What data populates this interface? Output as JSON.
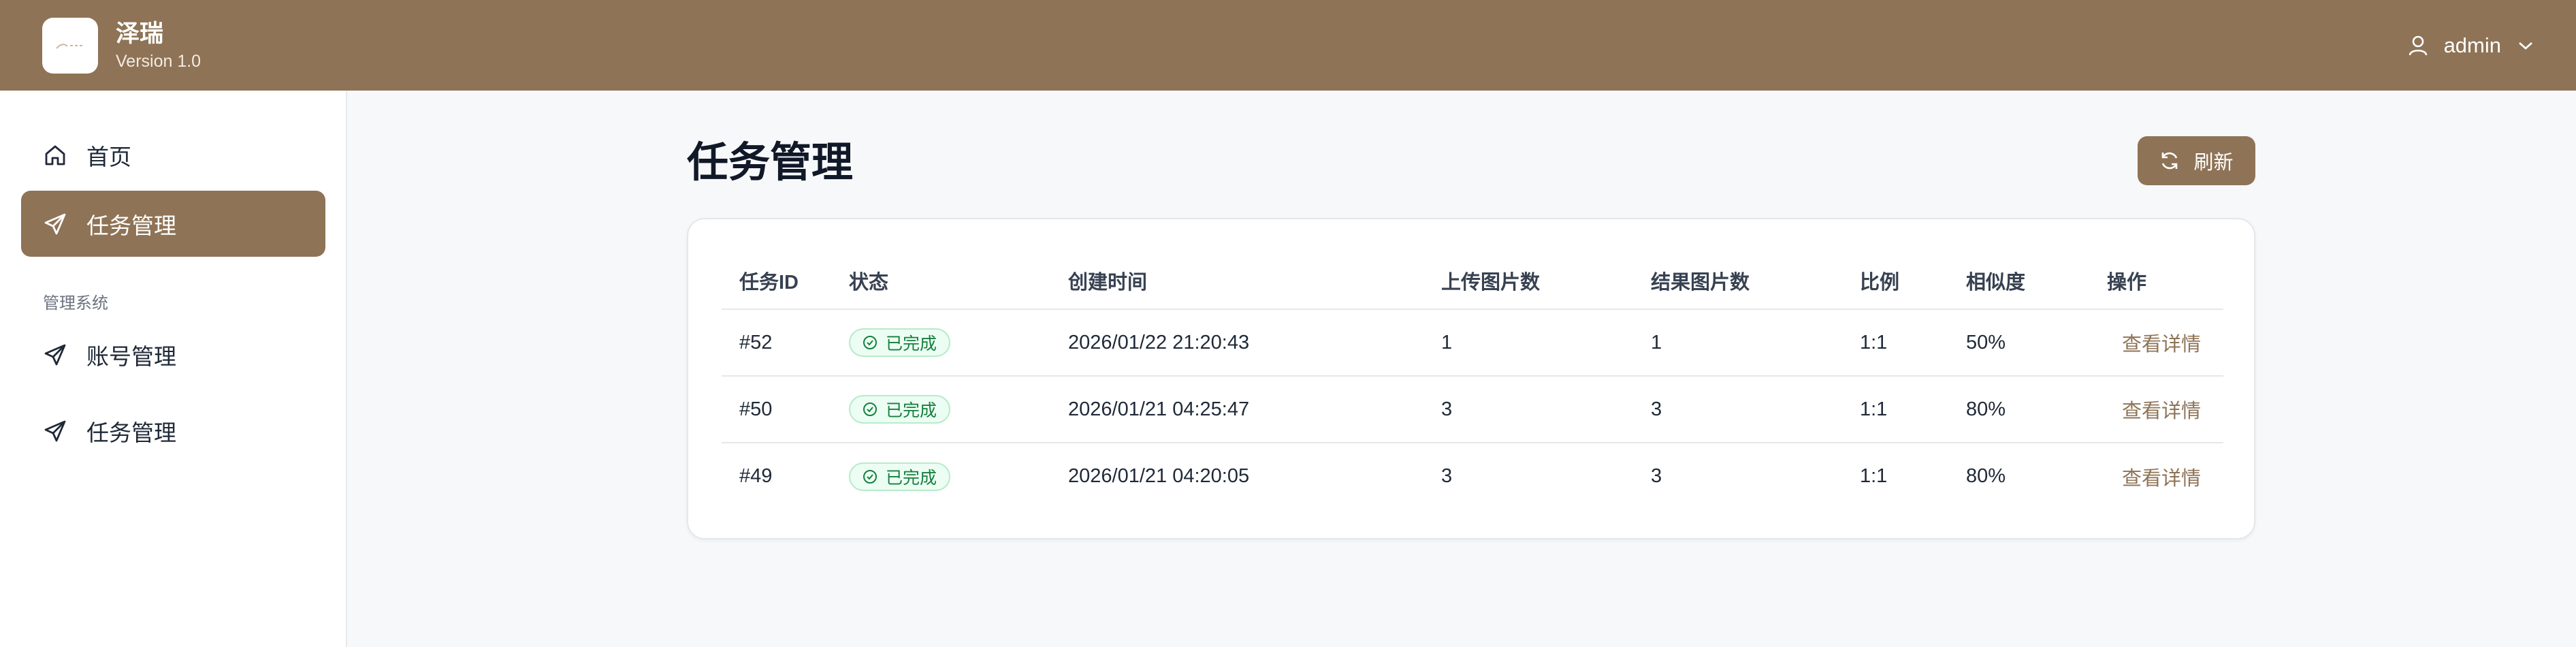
{
  "app": {
    "name": "泽瑞",
    "version": "Version 1.0",
    "user": "admin"
  },
  "sidebar": {
    "items": [
      {
        "label": "首页",
        "icon": "home-icon",
        "active": false
      },
      {
        "label": "任务管理",
        "icon": "send-icon",
        "active": true
      }
    ],
    "section_label": "管理系统",
    "section_items": [
      {
        "label": "账号管理",
        "icon": "send-icon"
      },
      {
        "label": "任务管理",
        "icon": "send-icon"
      }
    ]
  },
  "main": {
    "title": "任务管理",
    "refresh_label": "刷新",
    "table": {
      "headers": [
        "任务ID",
        "状态",
        "创建时间",
        "上传图片数",
        "结果图片数",
        "比例",
        "相似度",
        "操作"
      ],
      "rows": [
        {
          "id": "#52",
          "status": "已完成",
          "created": "2026/01/22 21:20:43",
          "uploaded": "1",
          "results": "1",
          "ratio": "1:1",
          "similarity": "50%",
          "action": "查看详情"
        },
        {
          "id": "#50",
          "status": "已完成",
          "created": "2026/01/21 04:25:47",
          "uploaded": "3",
          "results": "3",
          "ratio": "1:1",
          "similarity": "80%",
          "action": "查看详情"
        },
        {
          "id": "#49",
          "status": "已完成",
          "created": "2026/01/21 04:20:05",
          "uploaded": "3",
          "results": "3",
          "ratio": "1:1",
          "similarity": "80%",
          "action": "查看详情"
        }
      ]
    }
  },
  "colors": {
    "brand": "#8e7356",
    "success": "#15803d",
    "background": "#f7f8fa"
  }
}
